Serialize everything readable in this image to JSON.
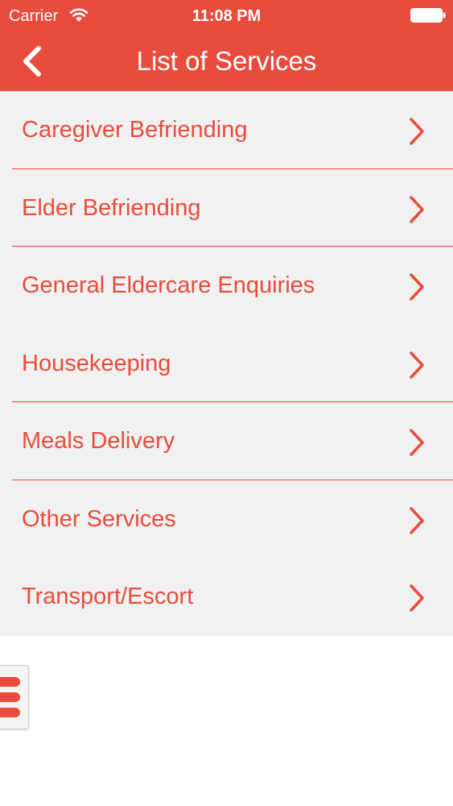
{
  "status_bar": {
    "carrier": "Carrier",
    "time": "11:08 PM",
    "wifi_icon": "wifi-icon",
    "battery_icon": "battery-icon"
  },
  "nav": {
    "title": "List of Services",
    "back_icon": "chevron-left-icon"
  },
  "services": {
    "items": [
      {
        "label": "Caregiver Befriending",
        "separator": true
      },
      {
        "label": "Elder Befriending",
        "separator": true
      },
      {
        "label": "General Eldercare Enquiries",
        "separator": false
      },
      {
        "label": "Housekeeping",
        "separator": true
      },
      {
        "label": "Meals Delivery",
        "separator": true
      },
      {
        "label": "Other Services",
        "separator": false
      },
      {
        "label": "Transport/Escort",
        "separator": false
      }
    ],
    "chevron_icon": "chevron-right-icon"
  },
  "menu_button": {
    "icon": "hamburger-menu-icon"
  },
  "colors": {
    "accent": "#e84c3d",
    "list_background": "#f1f1f1",
    "page_background": "#ffffff",
    "text_on_accent": "#ffffff"
  }
}
